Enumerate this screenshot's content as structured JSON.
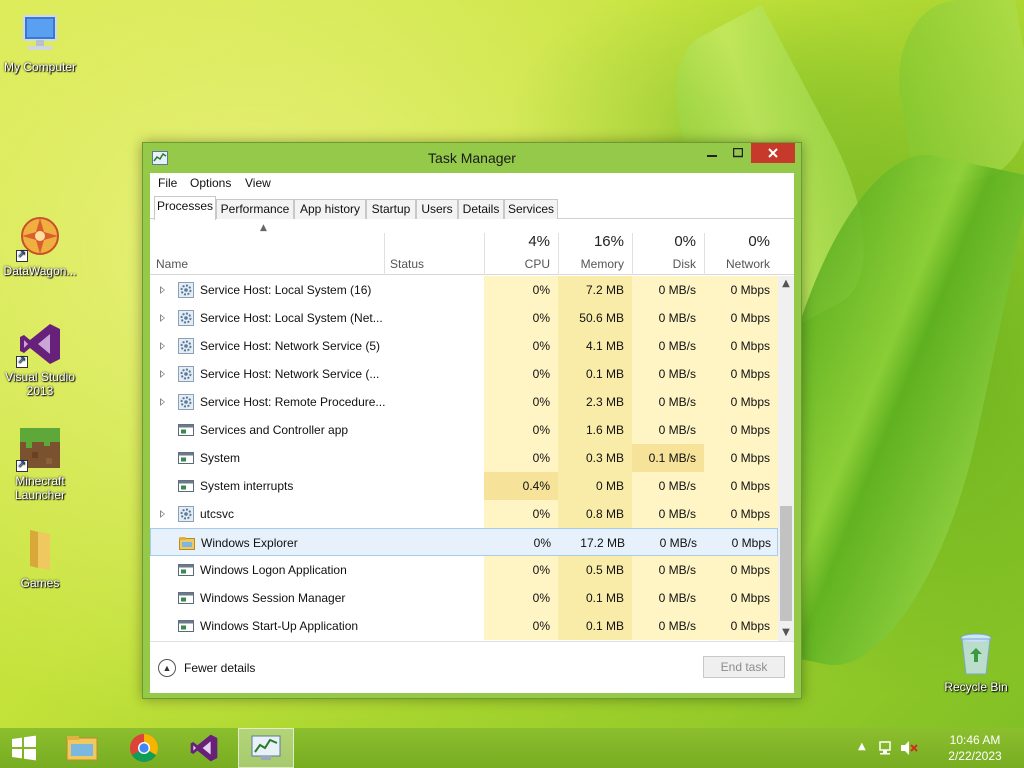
{
  "desktop": {
    "icons": [
      {
        "label": "My Computer",
        "icon": "computer-icon"
      },
      {
        "label": "DataWagon...",
        "icon": "datawagon-icon"
      },
      {
        "label": "Visual Studio 2013",
        "icon": "visual-studio-icon"
      },
      {
        "label": "Minecraft Launcher",
        "icon": "minecraft-icon"
      },
      {
        "label": "Games",
        "icon": "folder-icon"
      },
      {
        "label": "Recycle Bin",
        "icon": "recycle-bin-icon"
      }
    ]
  },
  "window": {
    "title": "Task Manager",
    "menu": [
      "File",
      "Options",
      "View"
    ],
    "tabs": [
      "Processes",
      "Performance",
      "App history",
      "Startup",
      "Users",
      "Details",
      "Services"
    ],
    "active_tab": "Processes",
    "columns": {
      "name": "Name",
      "status": "Status",
      "cpu": {
        "pct": "4%",
        "label": "CPU"
      },
      "memory": {
        "pct": "16%",
        "label": "Memory"
      },
      "disk": {
        "pct": "0%",
        "label": "Disk"
      },
      "network": {
        "pct": "0%",
        "label": "Network"
      }
    },
    "rows": [
      {
        "name": "Service Host: Local System (16)",
        "cpu": "0%",
        "memory": "7.2 MB",
        "disk": "0 MB/s",
        "network": "0 Mbps",
        "icon": "gear-icon",
        "expandable": true
      },
      {
        "name": "Service Host: Local System (Net...",
        "cpu": "0%",
        "memory": "50.6 MB",
        "disk": "0 MB/s",
        "network": "0 Mbps",
        "icon": "gear-icon",
        "expandable": true
      },
      {
        "name": "Service Host: Network Service (5)",
        "cpu": "0%",
        "memory": "4.1 MB",
        "disk": "0 MB/s",
        "network": "0 Mbps",
        "icon": "gear-icon",
        "expandable": true
      },
      {
        "name": "Service Host: Network Service (...",
        "cpu": "0%",
        "memory": "0.1 MB",
        "disk": "0 MB/s",
        "network": "0 Mbps",
        "icon": "gear-icon",
        "expandable": true
      },
      {
        "name": "Service Host: Remote Procedure...",
        "cpu": "0%",
        "memory": "2.3 MB",
        "disk": "0 MB/s",
        "network": "0 Mbps",
        "icon": "gear-icon",
        "expandable": true
      },
      {
        "name": "Services and Controller app",
        "cpu": "0%",
        "memory": "1.6 MB",
        "disk": "0 MB/s",
        "network": "0 Mbps",
        "icon": "app-window-icon",
        "expandable": false
      },
      {
        "name": "System",
        "cpu": "0%",
        "memory": "0.3 MB",
        "disk": "0.1 MB/s",
        "network": "0 Mbps",
        "icon": "app-window-icon",
        "expandable": false
      },
      {
        "name": "System interrupts",
        "cpu": "0.4%",
        "memory": "0 MB",
        "disk": "0 MB/s",
        "network": "0 Mbps",
        "icon": "app-window-icon",
        "expandable": false
      },
      {
        "name": "utcsvc",
        "cpu": "0%",
        "memory": "0.8 MB",
        "disk": "0 MB/s",
        "network": "0 Mbps",
        "icon": "gear-icon",
        "expandable": true
      },
      {
        "name": "Windows Explorer",
        "cpu": "0%",
        "memory": "17.2 MB",
        "disk": "0 MB/s",
        "network": "0 Mbps",
        "icon": "folder-icon",
        "expandable": false,
        "selected": true
      },
      {
        "name": "Windows Logon Application",
        "cpu": "0%",
        "memory": "0.5 MB",
        "disk": "0 MB/s",
        "network": "0 Mbps",
        "icon": "app-window-icon",
        "expandable": false
      },
      {
        "name": "Windows Session Manager",
        "cpu": "0%",
        "memory": "0.1 MB",
        "disk": "0 MB/s",
        "network": "0 Mbps",
        "icon": "app-window-icon",
        "expandable": false
      },
      {
        "name": "Windows Start-Up Application",
        "cpu": "0%",
        "memory": "0.1 MB",
        "disk": "0 MB/s",
        "network": "0 Mbps",
        "icon": "app-window-icon",
        "expandable": false
      }
    ],
    "footer": {
      "fewer_details": "Fewer details",
      "end_task": "End task"
    }
  },
  "taskbar": {
    "items": [
      "start-icon",
      "file-explorer-icon",
      "chrome-icon",
      "visual-studio-icon",
      "task-manager-icon"
    ],
    "clock": {
      "time": "10:46 AM",
      "date": "2/22/2023"
    }
  },
  "colors": {
    "heat_light": "#fff4c4",
    "heat_mid": "#f9eca8",
    "selected": "#e6f1fb",
    "close": "#c7392b"
  }
}
